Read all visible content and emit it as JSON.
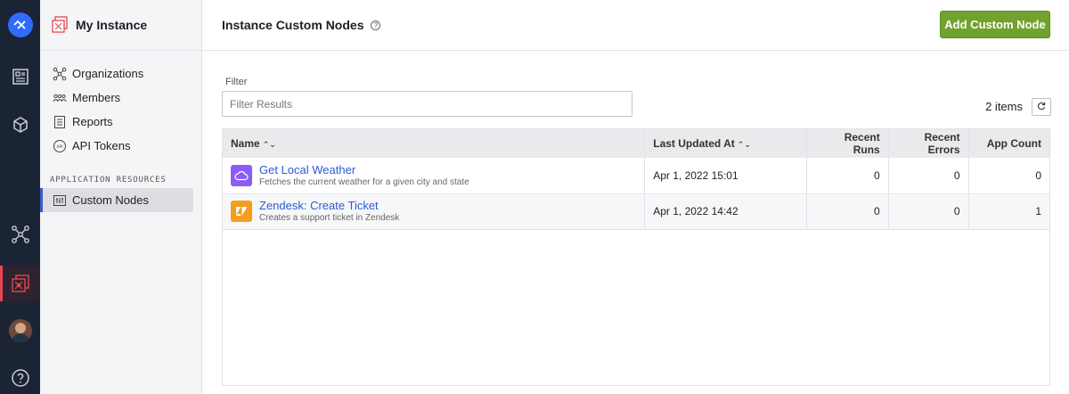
{
  "rail": {
    "items": [
      {
        "icon": "brand-logo-icon"
      },
      {
        "icon": "dashboard-icon"
      },
      {
        "icon": "cube-icon"
      },
      {
        "icon": "network-icon"
      },
      {
        "icon": "instance-icon"
      },
      {
        "icon": "avatar"
      },
      {
        "icon": "help-icon"
      }
    ],
    "accent": "#e8454c"
  },
  "sidebar": {
    "title": "My Instance",
    "items": [
      {
        "label": "Organizations",
        "icon": "organizations-icon"
      },
      {
        "label": "Members",
        "icon": "members-icon"
      },
      {
        "label": "Reports",
        "icon": "reports-icon"
      },
      {
        "label": "API Tokens",
        "icon": "api-tokens-icon"
      }
    ],
    "section_label": "APPLICATION RESOURCES",
    "section_items": [
      {
        "label": "Custom Nodes",
        "icon": "custom-nodes-icon",
        "active": true
      }
    ]
  },
  "header": {
    "title": "Instance Custom Nodes",
    "add_button": "Add Custom Node",
    "accent": "#71a22e"
  },
  "filter": {
    "label": "Filter",
    "placeholder": "Filter Results",
    "value": ""
  },
  "results": {
    "count": "2 items"
  },
  "table": {
    "columns": [
      "Name",
      "Last Updated At",
      "Recent Runs",
      "Recent Errors",
      "App Count"
    ],
    "rows": [
      {
        "name": "Get Local Weather",
        "description": "Fetches the current weather for a given city and state",
        "icon": "cloud-icon",
        "icon_color": "#8b5cf6",
        "updated": "Apr 1, 2022 15:01",
        "recent_runs": "0",
        "recent_errors": "0",
        "app_count": "0"
      },
      {
        "name": "Zendesk: Create Ticket",
        "description": "Creates a support ticket in Zendesk",
        "icon": "zendesk-icon",
        "icon_color": "#f59e1b",
        "updated": "Apr 1, 2022 14:42",
        "recent_runs": "0",
        "recent_errors": "0",
        "app_count": "1"
      }
    ]
  }
}
